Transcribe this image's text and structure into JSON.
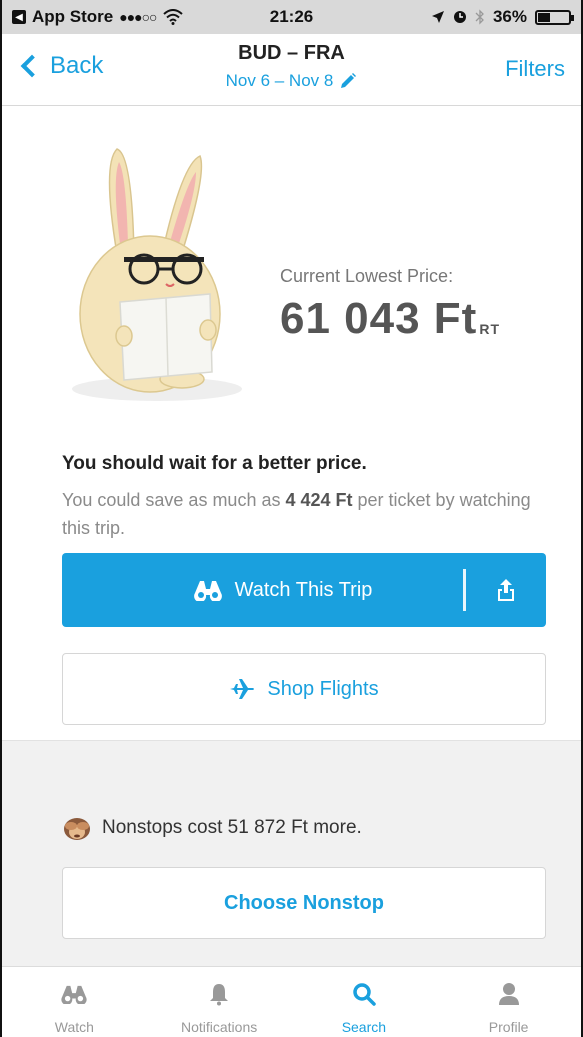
{
  "status_bar": {
    "carrier": "App Store",
    "signal_dots": "●●●○○",
    "time": "21:26",
    "battery": "36%"
  },
  "nav": {
    "back_label": "Back",
    "title": "BUD – FRA",
    "dates": "Nov 6 – Nov 8",
    "filters_label": "Filters"
  },
  "hero": {
    "price_label": "Current Lowest Price:",
    "price_value": "61 043 Ft",
    "price_suffix": "RT"
  },
  "advice": {
    "title": "You should wait for a better price.",
    "body_prefix": "You could save as much as ",
    "body_amount": "4 424 Ft",
    "body_suffix": " per ticket by watching this trip."
  },
  "buttons": {
    "watch_label": "Watch This Trip",
    "shop_label": "Shop Flights",
    "choose_nonstop_label": "Choose Nonstop"
  },
  "nonstop": {
    "text": "Nonstops cost 51 872 Ft more."
  },
  "tabs": [
    {
      "label": "Watch",
      "icon": "binoculars-icon",
      "active": false
    },
    {
      "label": "Notifications",
      "icon": "bell-icon",
      "active": false
    },
    {
      "label": "Search",
      "icon": "search-icon",
      "active": true
    },
    {
      "label": "Profile",
      "icon": "person-icon",
      "active": false
    }
  ],
  "colors": {
    "accent": "#1aa0de",
    "section_bg": "#f1f1f1"
  }
}
